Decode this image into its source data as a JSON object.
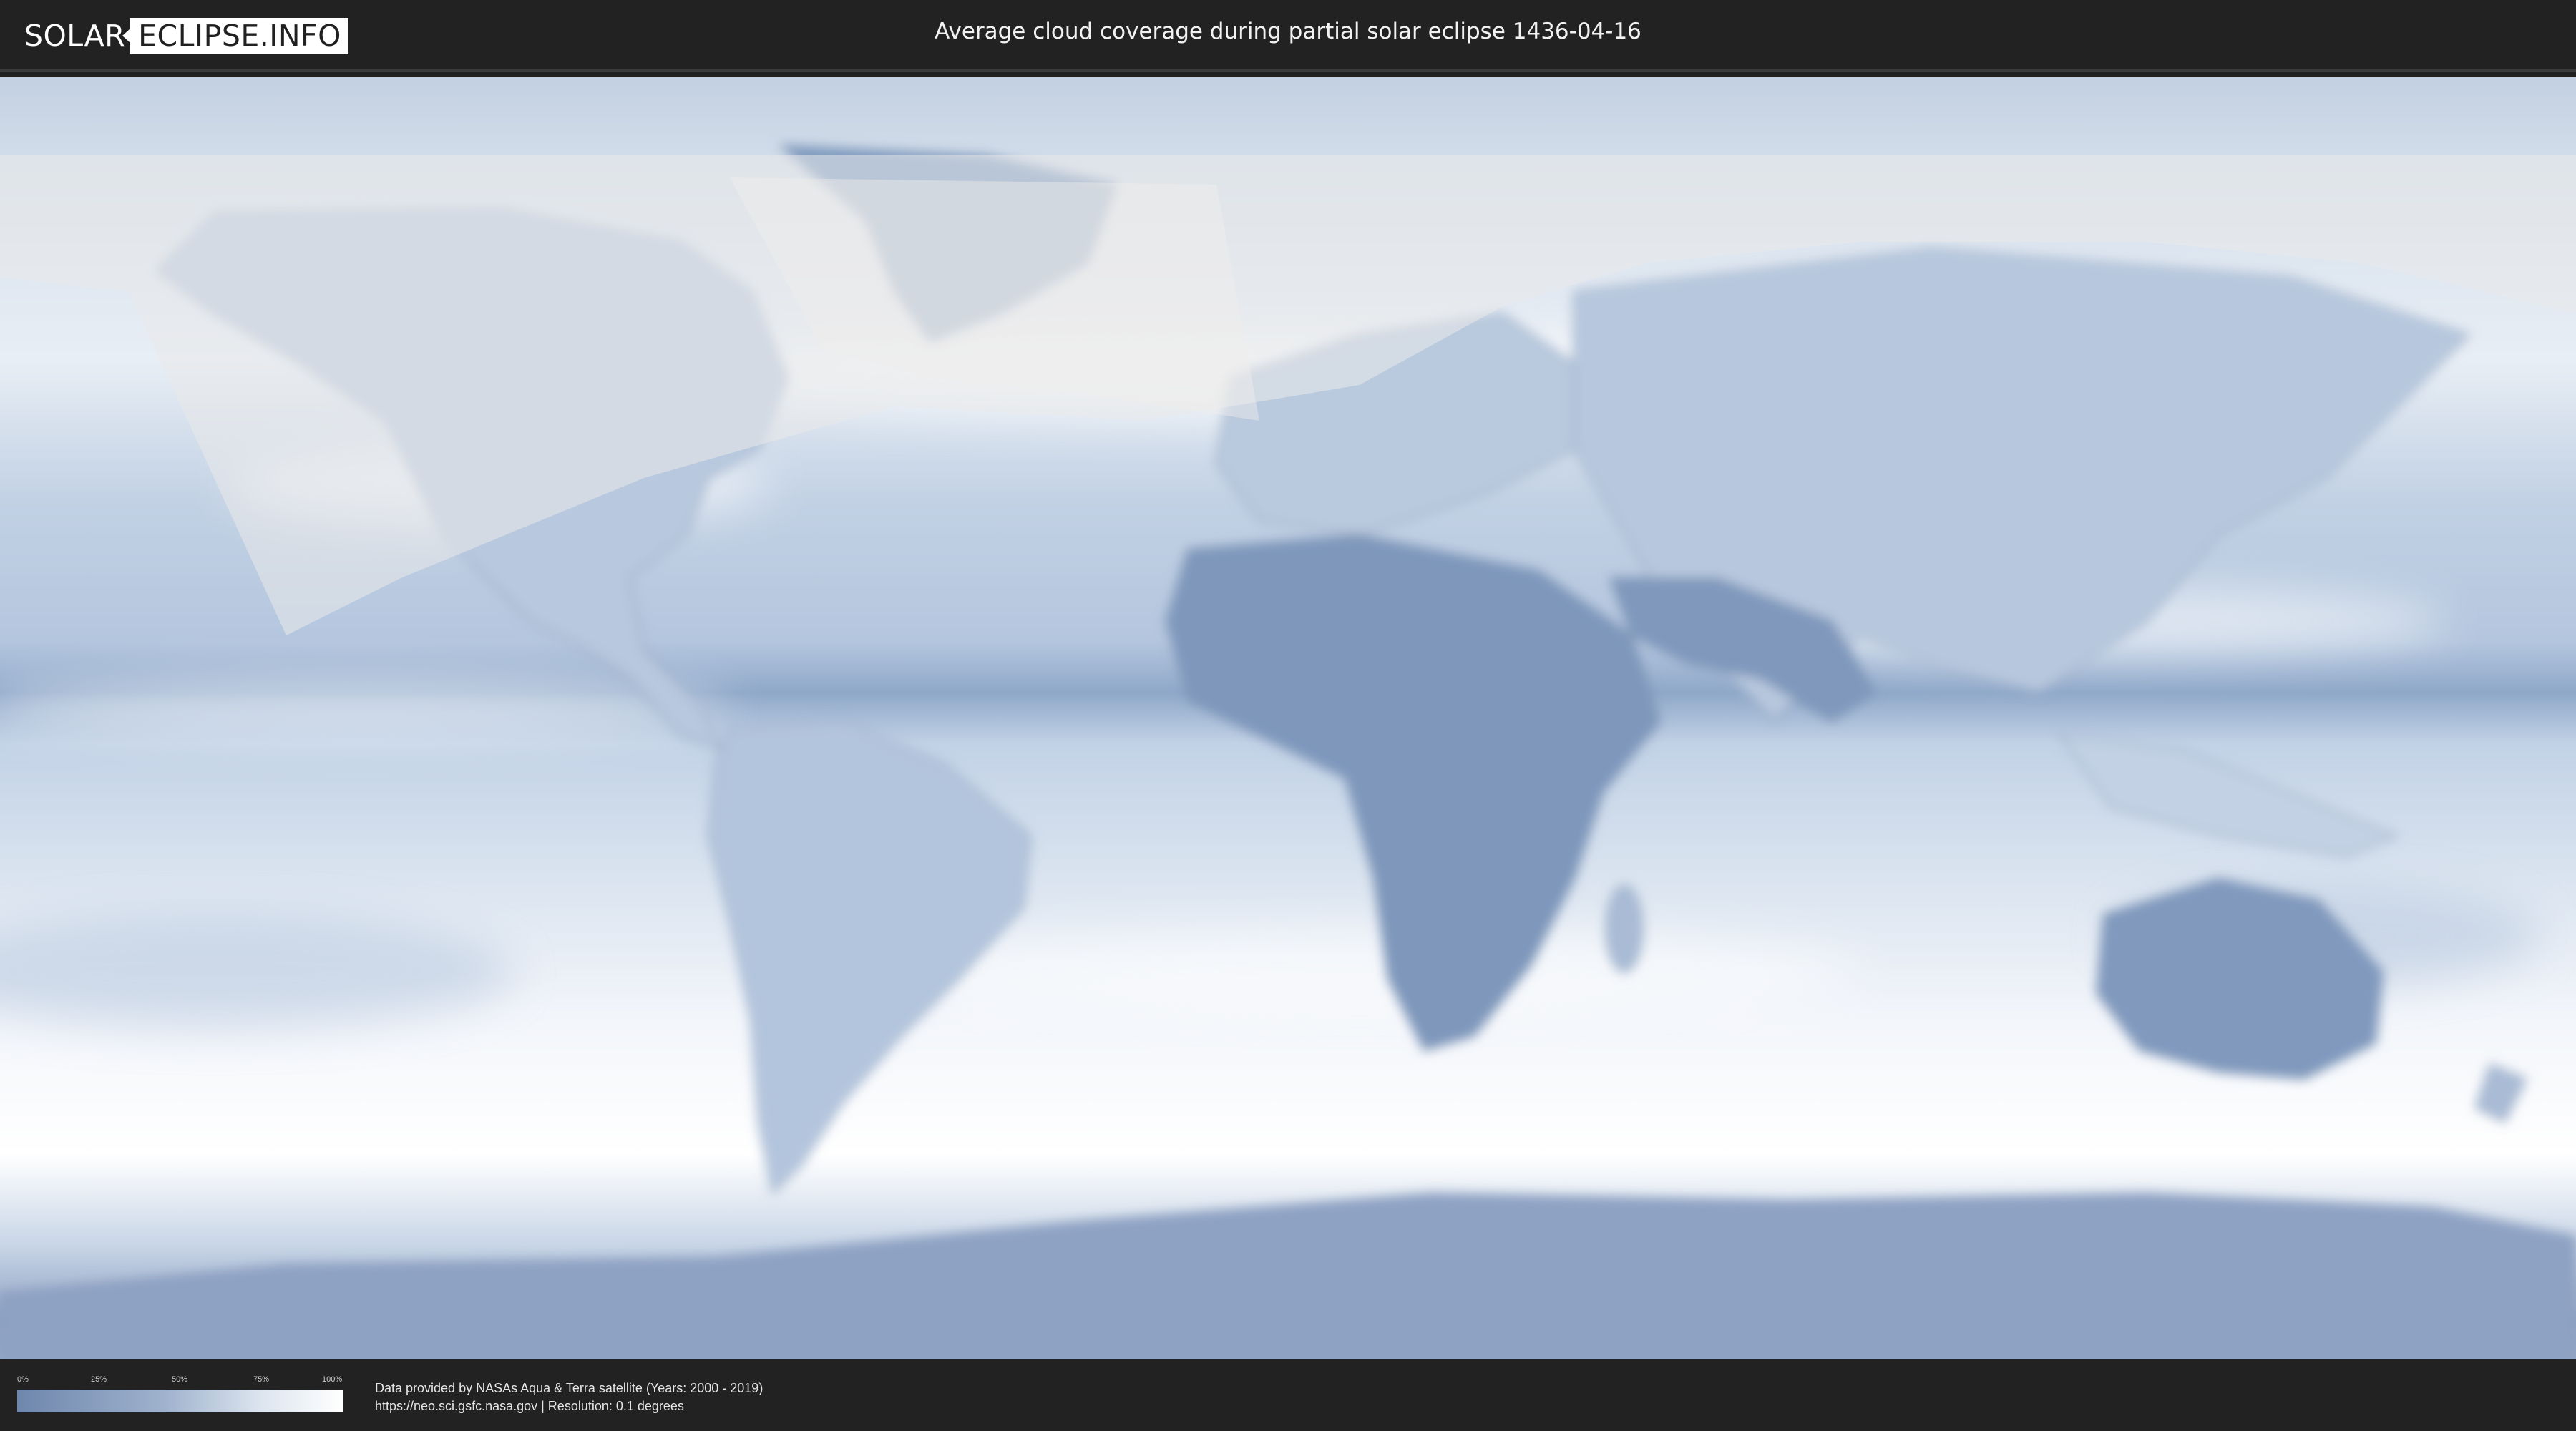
{
  "header": {
    "logo": {
      "left": "SOLAR",
      "right": "ECLIPSE.INFO"
    },
    "title": "Average cloud coverage during partial solar eclipse 1436-04-16"
  },
  "map": {
    "type": "cloud-coverage world map",
    "projection": "equirectangular",
    "eclipse_visibility_overlay": "pale shaded zone over North Atlantic, Europe, Asia and North Pacific",
    "colors": {
      "clear_sky": "#6f87ad",
      "full_cloud": "#ffffff",
      "overlay": "#e9e9ea"
    }
  },
  "legend": {
    "ticks": [
      "0%",
      "25%",
      "50%",
      "75%",
      "100%"
    ],
    "range": [
      0,
      100
    ],
    "unit": "%"
  },
  "credits": {
    "line1": "Data provided by NASAs Aqua & Terra satellite (Years: 2000 - 2019)",
    "line2": "https://neo.sci.gsfc.nasa.gov | Resolution: 0.1 degrees"
  }
}
